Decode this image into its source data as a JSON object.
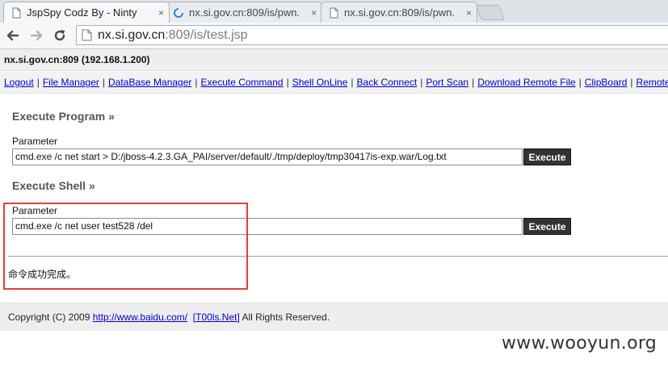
{
  "browser": {
    "tabs": [
      {
        "title": "JspSpy Codz By - Ninty",
        "active": true
      },
      {
        "title": "nx.si.gov.cn:809/is/pwn.",
        "loading": true
      },
      {
        "title": "nx.si.gov.cn:809/is/pwn."
      }
    ],
    "tab_close_glyph": "×",
    "url_host": "nx.si.gov.cn",
    "url_rest": ":809/is/test.jsp"
  },
  "page": {
    "host_info": "nx.si.gov.cn:809 (192.168.1.200)",
    "menu": [
      "Logout",
      "File Manager",
      "DataBase Manager",
      "Execute Command",
      "Shell OnLine",
      "Back Connect",
      "Port Scan",
      "Download Remote File",
      "ClipBoard",
      "Remote"
    ],
    "menu_separator": "|",
    "sections": [
      {
        "title": "Execute Program",
        "param_label": "Parameter",
        "value": "cmd.exe /c net start > D:/jboss-4.2.3.GA_PAI/server/default/./tmp/deploy/tmp30417is-exp.war/Log.txt",
        "button": "Execute"
      },
      {
        "title": "Execute Shell",
        "param_label": "Parameter",
        "value": "cmd.exe /c net user test528 /del",
        "button": "Execute"
      }
    ],
    "section_suffix": "»",
    "result_text": "命令成功完成。",
    "footer": {
      "prefix": "Copyright (C) 2009 ",
      "link1": "http://www.baidu.com/",
      "link2": "[T00ls.Net]",
      "suffix": " All Rights Reserved."
    },
    "watermark": "www.wooyun.org"
  },
  "colors": {
    "highlight_border": "#e33d3d",
    "link": "#0000cc",
    "button_bg": "#333333"
  }
}
